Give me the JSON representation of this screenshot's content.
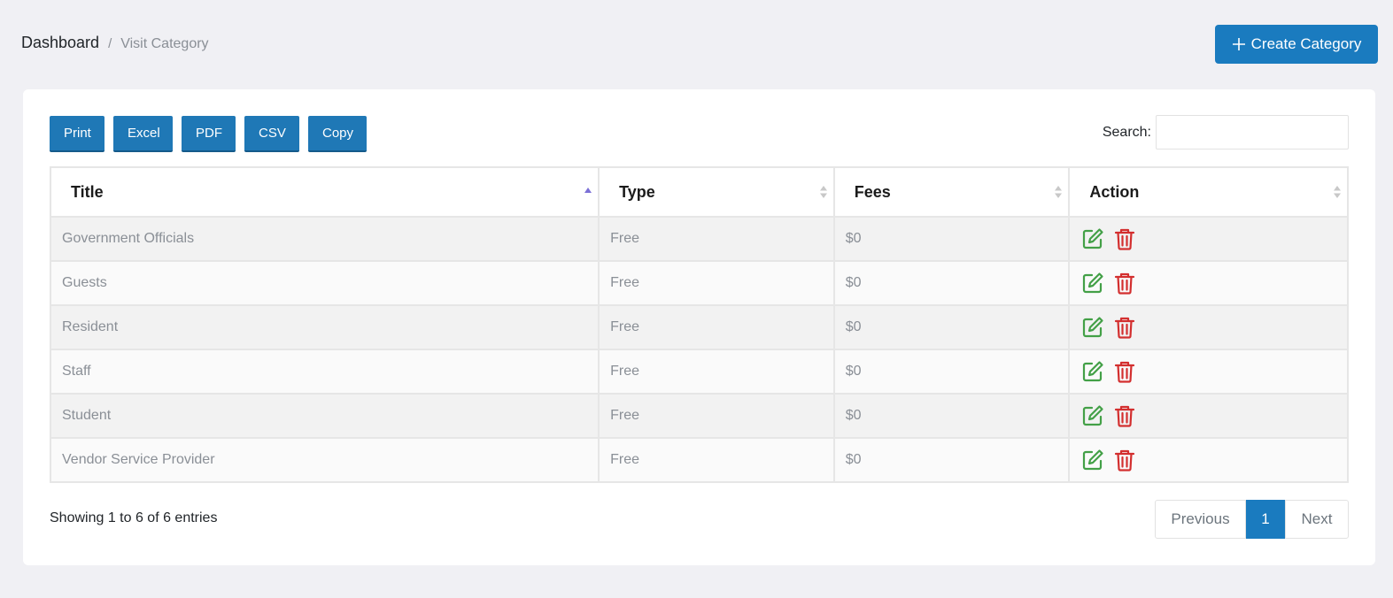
{
  "breadcrumb": {
    "home": "Dashboard",
    "separator": "/",
    "current": "Visit Category"
  },
  "create_button": {
    "label": "Create Category",
    "icon": "plus-icon"
  },
  "export_buttons": [
    "Print",
    "Excel",
    "PDF",
    "CSV",
    "Copy"
  ],
  "search": {
    "label": "Search:",
    "value": "",
    "placeholder": ""
  },
  "table": {
    "headers": [
      "Title",
      "Type",
      "Fees",
      "Action"
    ],
    "sorted_column": "Title",
    "sort_direction": "ascending",
    "rows": [
      {
        "title": "Government Officials",
        "type": "Free",
        "fees": "$0"
      },
      {
        "title": "Guests",
        "type": "Free",
        "fees": "$0"
      },
      {
        "title": "Resident",
        "type": "Free",
        "fees": "$0"
      },
      {
        "title": "Staff",
        "type": "Free",
        "fees": "$0"
      },
      {
        "title": "Student",
        "type": "Free",
        "fees": "$0"
      },
      {
        "title": "Vendor Service Provider",
        "type": "Free",
        "fees": "$0"
      }
    ],
    "action_icons": [
      "edit-icon",
      "trash-icon"
    ]
  },
  "info": "Showing 1 to 6 of 6 entries",
  "pagination": {
    "previous": "Previous",
    "current_page": "1",
    "next": "Next"
  },
  "colors": {
    "primary": "#1a7bbf",
    "edit": "#43a047",
    "delete": "#d32f2f",
    "sort_active": "#7b6fd6",
    "sort_inactive": "#c8c8c8"
  }
}
